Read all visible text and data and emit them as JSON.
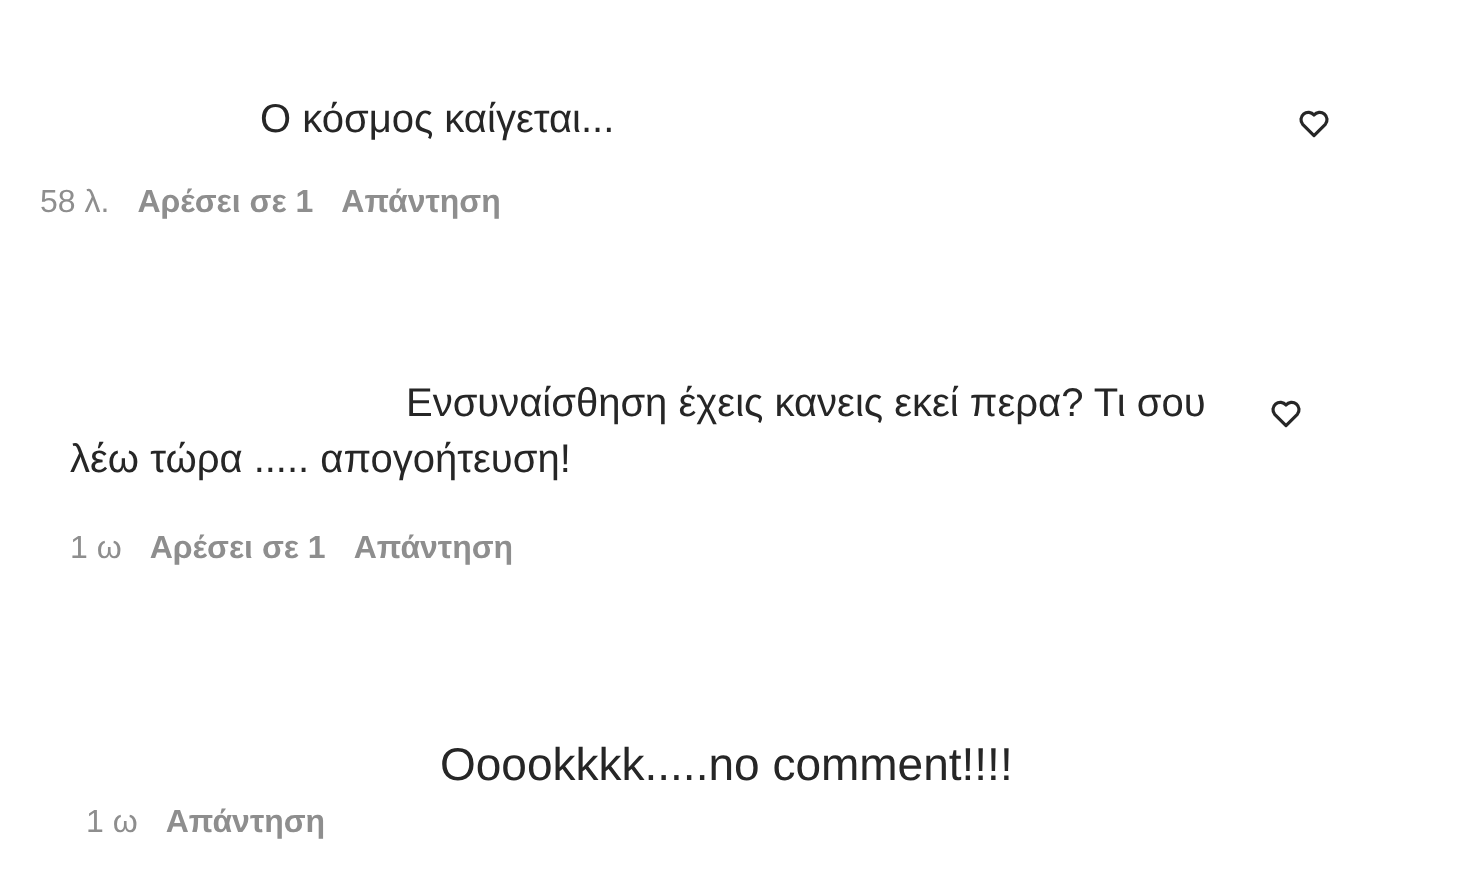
{
  "comments": [
    {
      "text": "Ο κόσμος καίγεται...",
      "time": "58 λ.",
      "likes": "Αρέσει σε 1",
      "reply": "Απάντηση",
      "heart": true
    },
    {
      "text": "Ενσυναίσθηση έχεις κανεις εκεί περα? Τι σου λέω τώρα ..... απογοήτευση!",
      "time": "1 ω",
      "likes": "Αρέσει σε 1",
      "reply": "Απάντηση",
      "heart": true
    },
    {
      "text": "Ooookkkk.....no comment!!!!",
      "time": "1 ω",
      "reply": "Απάντηση",
      "heart": false
    }
  ]
}
